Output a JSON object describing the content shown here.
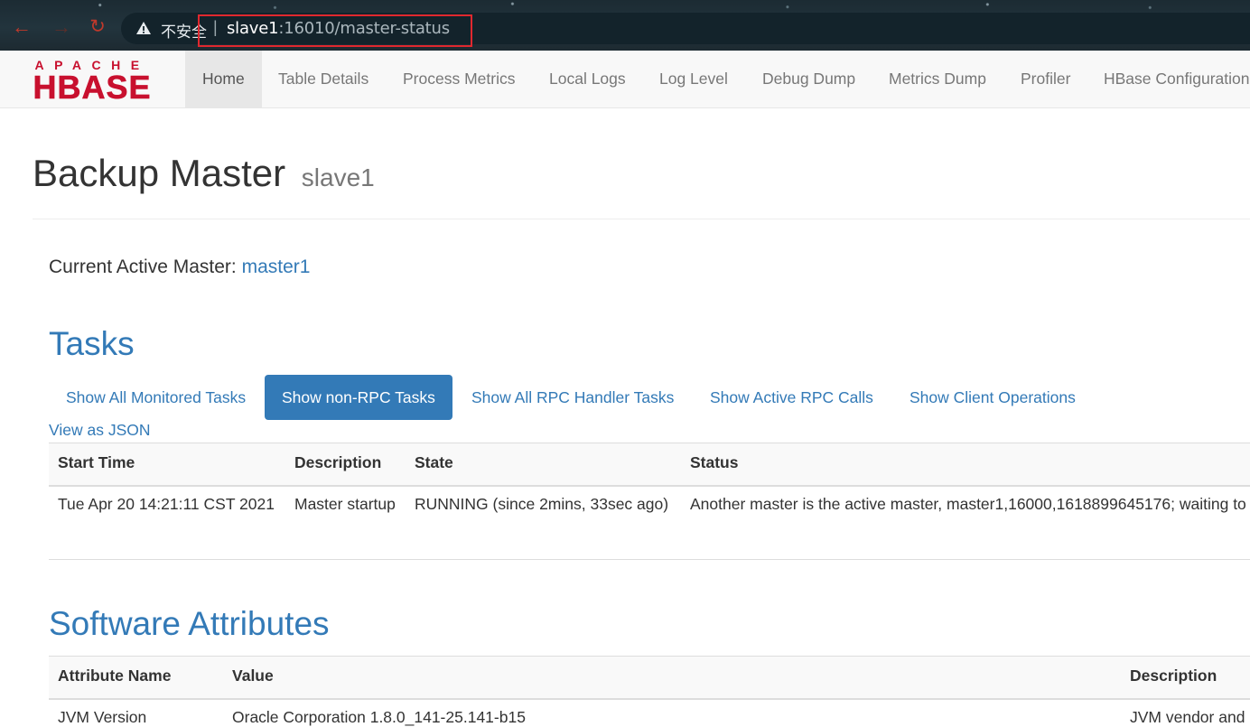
{
  "browser": {
    "security_label": "不安全",
    "separator": "|",
    "url_host": "slave1",
    "url_rest": ":16010/master-status"
  },
  "logo": {
    "top": "APACHE",
    "main": "HBASE"
  },
  "nav": {
    "items": [
      {
        "label": "Home",
        "active": true
      },
      {
        "label": "Table Details"
      },
      {
        "label": "Process Metrics"
      },
      {
        "label": "Local Logs"
      },
      {
        "label": "Log Level"
      },
      {
        "label": "Debug Dump"
      },
      {
        "label": "Metrics Dump"
      },
      {
        "label": "Profiler"
      },
      {
        "label": "HBase Configuration"
      }
    ]
  },
  "page": {
    "title": "Backup Master",
    "subtitle": "slave1",
    "active_master_label": "Current Active Master:",
    "active_master_link": "master1"
  },
  "tasks": {
    "title": "Tasks",
    "tabs": [
      {
        "label": "Show All Monitored Tasks"
      },
      {
        "label": "Show non-RPC Tasks",
        "active": true
      },
      {
        "label": "Show All RPC Handler Tasks"
      },
      {
        "label": "Show Active RPC Calls"
      },
      {
        "label": "Show Client Operations"
      }
    ],
    "json_link": "View as JSON",
    "columns": [
      "Start Time",
      "Description",
      "State",
      "Status"
    ],
    "rows": [
      {
        "start_time": "Tue Apr 20 14:21:11 CST 2021",
        "description": "Master startup",
        "state": "RUNNING (since 2mins, 33sec ago)",
        "status": "Another master is the active master, master1,16000,1618899645176; waiting to"
      }
    ]
  },
  "software": {
    "title": "Software Attributes",
    "columns": [
      "Attribute Name",
      "Value",
      "Description"
    ],
    "rows": [
      {
        "name": "JVM Version",
        "value": "Oracle Corporation 1.8.0_141-25.141-b15",
        "description": "JVM vendor and"
      }
    ]
  },
  "colors": {
    "link": "#337ab7",
    "logo_red": "#c8102e",
    "highlight": "#e0282f"
  }
}
